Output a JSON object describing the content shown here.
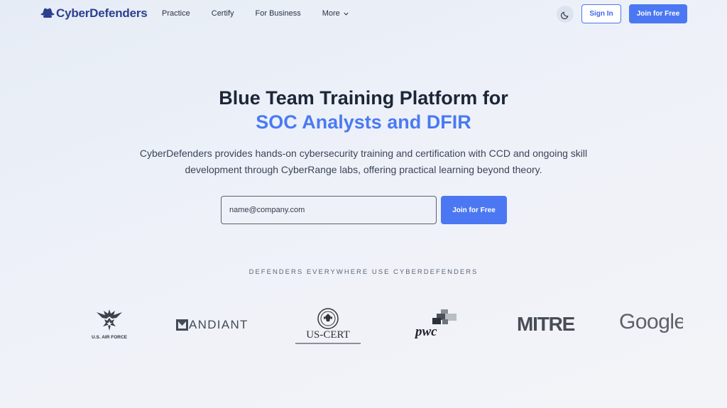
{
  "nav": {
    "logo_text": "CyberDefenders",
    "links": [
      "Practice",
      "Certify",
      "For Business",
      "More"
    ],
    "sign_in_label": "Sign In",
    "join_label": "Join for Free",
    "theme_icon": "moon-icon"
  },
  "hero": {
    "title_line1": "Blue Team Training Platform for",
    "title_line2": "SOC Analysts and DFIR",
    "description": "CyberDefenders provides hands-on cybersecurity training and certification with CCD and ongoing skill development through CyberRange labs, offering practical learning beyond theory.",
    "email_placeholder": "name@company.com",
    "join_label": "Join for Free"
  },
  "clients": {
    "heading": "DEFENDERS EVERYWHERE USE CYBERDEFENDERS",
    "logos": {
      "air_force": "U.S. AIR FORCE",
      "mandiant": "ANDIANT",
      "uscert": "US-CERT",
      "pwc": "pwc",
      "mitre": "MITRE",
      "google": "Google"
    }
  },
  "colors": {
    "accent": "#4b78f2",
    "title": "#1c2638",
    "logo": "#2b3f8f"
  }
}
